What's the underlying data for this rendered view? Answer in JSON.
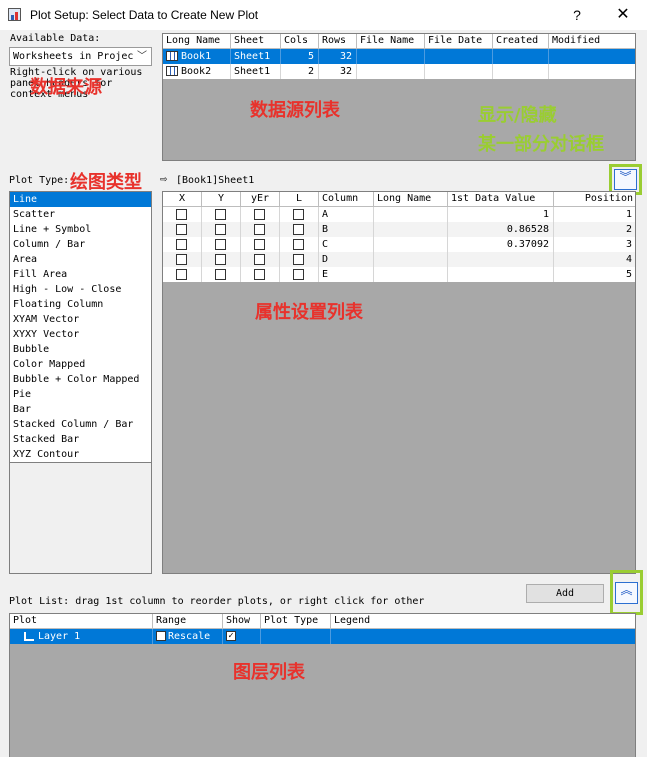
{
  "window": {
    "title": "Plot Setup: Select Data to Create New Plot",
    "help": "?",
    "close": "✕"
  },
  "available": {
    "label": "Available Data:",
    "selected": "Worksheets in Projec",
    "hint": "Right-click on various panel headers for context menus"
  },
  "source_table": {
    "headers": [
      "Long Name",
      "Sheet",
      "Cols",
      "Rows",
      "File Name",
      "File Date",
      "Created",
      "Modified"
    ],
    "rows": [
      {
        "long_name": "Book1",
        "sheet": "Sheet1",
        "cols": "5",
        "rows": "32"
      },
      {
        "long_name": "Book2",
        "sheet": "Sheet1",
        "cols": "2",
        "rows": "32"
      }
    ]
  },
  "plot_type": {
    "label": "Plot Type:",
    "dataset": "[Book1]Sheet1",
    "items": [
      "Line",
      "Scatter",
      "Line + Symbol",
      "Column / Bar",
      "Area",
      "Fill Area",
      "High - Low - Close",
      "Floating Column",
      "XYAM Vector",
      "XYXY Vector",
      "Bubble",
      "Color Mapped",
      "Bubble + Color Mapped",
      "Pie",
      "Bar",
      "Stacked Column / Bar",
      "Stacked Bar",
      "XYZ Contour"
    ]
  },
  "prop_table": {
    "headers": [
      "X",
      "Y",
      "yEr",
      "L",
      "Column",
      "Long Name",
      "1st Data Value",
      "Position"
    ],
    "rows": [
      {
        "column": "A",
        "first_value": "1",
        "position": "1"
      },
      {
        "column": "B",
        "first_value": "0.86528",
        "position": "2"
      },
      {
        "column": "C",
        "first_value": "0.37092",
        "position": "3"
      },
      {
        "column": "D",
        "first_value": "",
        "position": "4"
      },
      {
        "column": "E",
        "first_value": "",
        "position": "5"
      }
    ]
  },
  "plot_list": {
    "label": "Plot List: drag 1st column to reorder plots, or right click for other",
    "add": "Add",
    "headers": [
      "Plot",
      "Range",
      "Show",
      "Plot Type",
      "Legend"
    ],
    "rows": [
      {
        "plot": "Layer 1",
        "range": "Rescale",
        "show_mark": "✓"
      }
    ]
  },
  "annotations": {
    "data_source": "数据来源",
    "source_list": "数据源列表",
    "toggle_line1": "显示/隐藏",
    "toggle_line2": "某一部分对话框",
    "plot_type": "绘图类型",
    "prop_list": "属性设置列表",
    "layer_list": "图层列表"
  },
  "icons": {
    "expand": "chevron-double-down-icon",
    "collapse": "chevron-double-up-icon"
  },
  "colors": {
    "selection": "#0078d7",
    "annotation_red": "#e8322c",
    "annotation_green": "#9acd32",
    "grid_bg": "#a8a8a8"
  }
}
